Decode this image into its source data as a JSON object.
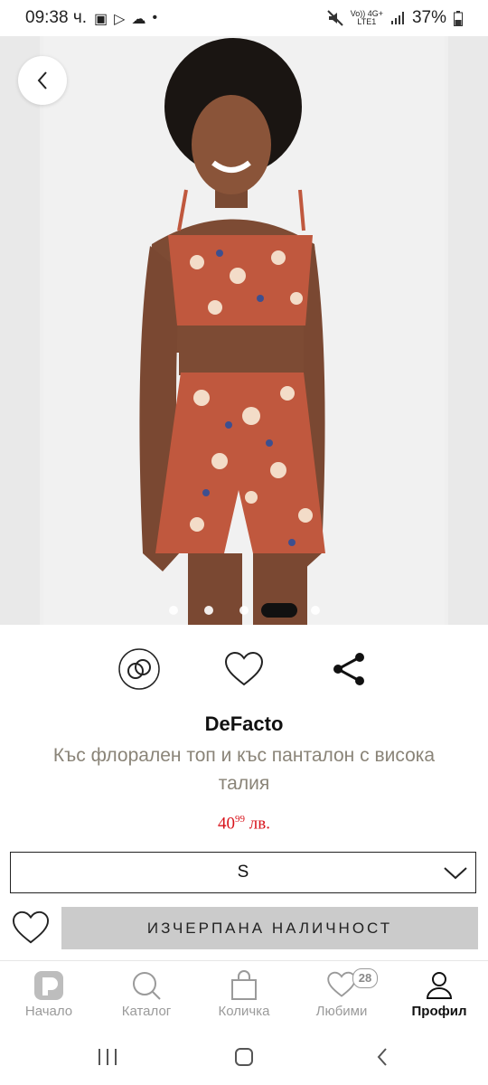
{
  "status_bar": {
    "time": "09:38 ч.",
    "network_top": "Vo)) 4G+",
    "network_bottom": "LTE1",
    "battery": "37%",
    "notification_dot": "•"
  },
  "gallery": {
    "image_alt": "Model wearing floral crop top and high-waist shorts",
    "slide_count": 5,
    "active_slide": 4
  },
  "actions": {
    "compare_icon": "rings-icon",
    "wishlist_icon": "heart-icon",
    "share_icon": "share-icon"
  },
  "product": {
    "brand": "DeFacto",
    "title": "Къс флорален топ и къс панталон с висока талия",
    "price_main": "40",
    "price_cents": "99",
    "currency": " лв."
  },
  "size_select": {
    "value": "S"
  },
  "cta": {
    "label": "ИЗЧЕРПАНА НАЛИЧНОСТ"
  },
  "bottom_nav": {
    "items": [
      {
        "label": "Начало",
        "icon": "home-logo-icon"
      },
      {
        "label": "Каталог",
        "icon": "search-icon"
      },
      {
        "label": "Количка",
        "icon": "bag-icon"
      },
      {
        "label": "Любими",
        "icon": "heart-icon"
      },
      {
        "label": "Профил",
        "icon": "profile-icon"
      }
    ],
    "favorites_badge": "28",
    "active": "Профил"
  },
  "colors": {
    "price": "#d8131b",
    "soldout_bg": "#cbcbcb",
    "title_gray": "#8a8478",
    "product_fabric": "#c0583e"
  }
}
